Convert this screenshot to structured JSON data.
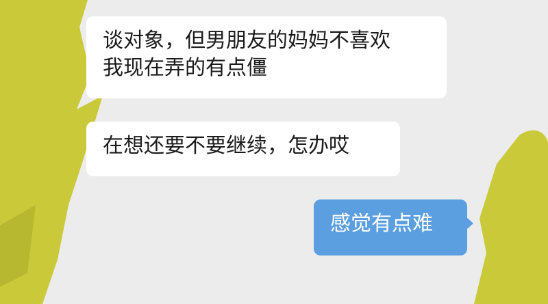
{
  "messages": [
    {
      "direction": "incoming",
      "lines": [
        "谈对象，但男朋友的妈妈不喜欢",
        "我现在弄的有点僵"
      ]
    },
    {
      "direction": "incoming",
      "lines": [
        "在想还要不要继续，怎办哎"
      ]
    },
    {
      "direction": "outgoing",
      "lines": [
        "感觉有点难"
      ]
    }
  ],
  "colors": {
    "background": "#ececec",
    "incoming_bubble": "#ffffff",
    "outgoing_bubble": "#5b9fe0",
    "redaction_marker": "#c9c93a"
  }
}
